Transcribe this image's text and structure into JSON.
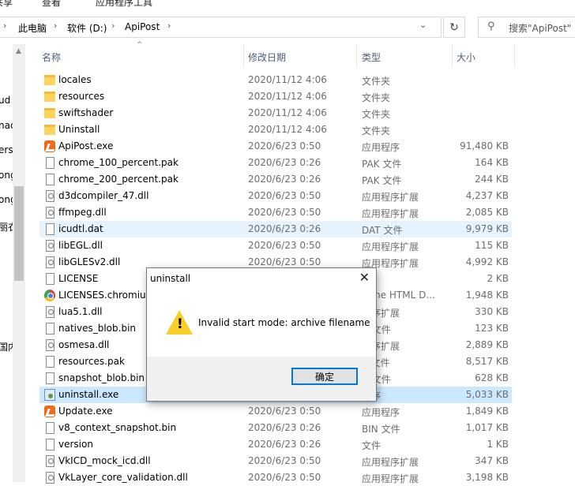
{
  "ribbon": {
    "tabs": [
      "共享",
      "查看",
      "应用程序工具"
    ]
  },
  "address": {
    "crumbs": [
      "此电脑",
      "软件 (D:)",
      "ApiPost"
    ]
  },
  "search": {
    "placeholder": "搜索\"ApiPost\""
  },
  "nav": {
    "labels": [
      "ud",
      "nac",
      "ers",
      "ong",
      "ong",
      "丽衣",
      "国内"
    ]
  },
  "columns": {
    "name": "名称",
    "date": "修改日期",
    "type": "类型",
    "size": "大小"
  },
  "files": [
    {
      "name": "locales",
      "date": "2020/11/12 4:06",
      "type": "文件夹",
      "size": "",
      "icon": "folder-icon"
    },
    {
      "name": "resources",
      "date": "2020/11/12 4:06",
      "type": "文件夹",
      "size": "",
      "icon": "folder-icon"
    },
    {
      "name": "swiftshader",
      "date": "2020/11/12 4:06",
      "type": "文件夹",
      "size": "",
      "icon": "folder-icon"
    },
    {
      "name": "Uninstall",
      "date": "2020/11/12 4:06",
      "type": "文件夹",
      "size": "",
      "icon": "folder-icon"
    },
    {
      "name": "ApiPost.exe",
      "date": "2020/6/23 0:50",
      "type": "应用程序",
      "size": "91,480 KB",
      "icon": "app-icon"
    },
    {
      "name": "chrome_100_percent.pak",
      "date": "2020/6/23 0:26",
      "type": "PAK 文件",
      "size": "164 KB",
      "icon": "file-icon"
    },
    {
      "name": "chrome_200_percent.pak",
      "date": "2020/6/23 0:26",
      "type": "PAK 文件",
      "size": "244 KB",
      "icon": "file-icon"
    },
    {
      "name": "d3dcompiler_47.dll",
      "date": "2020/6/23 0:50",
      "type": "应用程序扩展",
      "size": "4,237 KB",
      "icon": "dll-icon"
    },
    {
      "name": "ffmpeg.dll",
      "date": "2020/6/23 0:50",
      "type": "应用程序扩展",
      "size": "2,085 KB",
      "icon": "dll-icon"
    },
    {
      "name": "icudtl.dat",
      "date": "2020/6/23 0:26",
      "type": "DAT 文件",
      "size": "9,979 KB",
      "icon": "file-icon"
    },
    {
      "name": "libEGL.dll",
      "date": "2020/6/23 0:50",
      "type": "应用程序扩展",
      "size": "115 KB",
      "icon": "dll-icon"
    },
    {
      "name": "libGLESv2.dll",
      "date": "2020/6/23 0:50",
      "type": "应用程序扩展",
      "size": "4,992 KB",
      "icon": "dll-icon"
    },
    {
      "name": "LICENSE",
      "date": "",
      "type": "件",
      "size": "2 KB",
      "icon": "file-icon"
    },
    {
      "name": "LICENSES.chromium",
      "date": "",
      "type": "rome HTML D...",
      "size": "1,948 KB",
      "icon": "chrome-icon"
    },
    {
      "name": "lua5.1.dll",
      "date": "",
      "type": "程序扩展",
      "size": "330 KB",
      "icon": "dll-icon"
    },
    {
      "name": "natives_blob.bin",
      "date": "",
      "type": "N 文件",
      "size": "123 KB",
      "icon": "file-icon"
    },
    {
      "name": "osmesa.dll",
      "date": "",
      "type": "程序扩展",
      "size": "2,889 KB",
      "icon": "dll-icon"
    },
    {
      "name": "resources.pak",
      "date": "",
      "type": "K 文件",
      "size": "8,517 KB",
      "icon": "file-icon"
    },
    {
      "name": "snapshot_blob.bin",
      "date": "",
      "type": "N 文件",
      "size": "628 KB",
      "icon": "file-icon"
    },
    {
      "name": "uninstall.exe",
      "date": "",
      "type": "程序",
      "size": "5,033 KB",
      "icon": "setup-icon"
    },
    {
      "name": "Update.exe",
      "date": "2020/6/23 0:50",
      "type": "应用程序",
      "size": "1,849 KB",
      "icon": "app-icon"
    },
    {
      "name": "v8_context_snapshot.bin",
      "date": "2020/6/23 0:26",
      "type": "BIN 文件",
      "size": "1,017 KB",
      "icon": "file-icon"
    },
    {
      "name": "version",
      "date": "2020/6/23 0:26",
      "type": "文件",
      "size": "1 KB",
      "icon": "file-icon"
    },
    {
      "name": "VkICD_mock_icd.dll",
      "date": "2020/6/23 0:50",
      "type": "应用程序扩展",
      "size": "347 KB",
      "icon": "dll-icon"
    },
    {
      "name": "VkLayer_core_validation.dll",
      "date": "2020/6/23 0:50",
      "type": "应用程序扩展",
      "size": "3,198 KB",
      "icon": "dll-icon"
    }
  ],
  "selected_index": 19,
  "hover_index": 9,
  "dialog": {
    "title": "uninstall",
    "message": "Invalid start mode: archive filename",
    "ok_label": "确定"
  }
}
